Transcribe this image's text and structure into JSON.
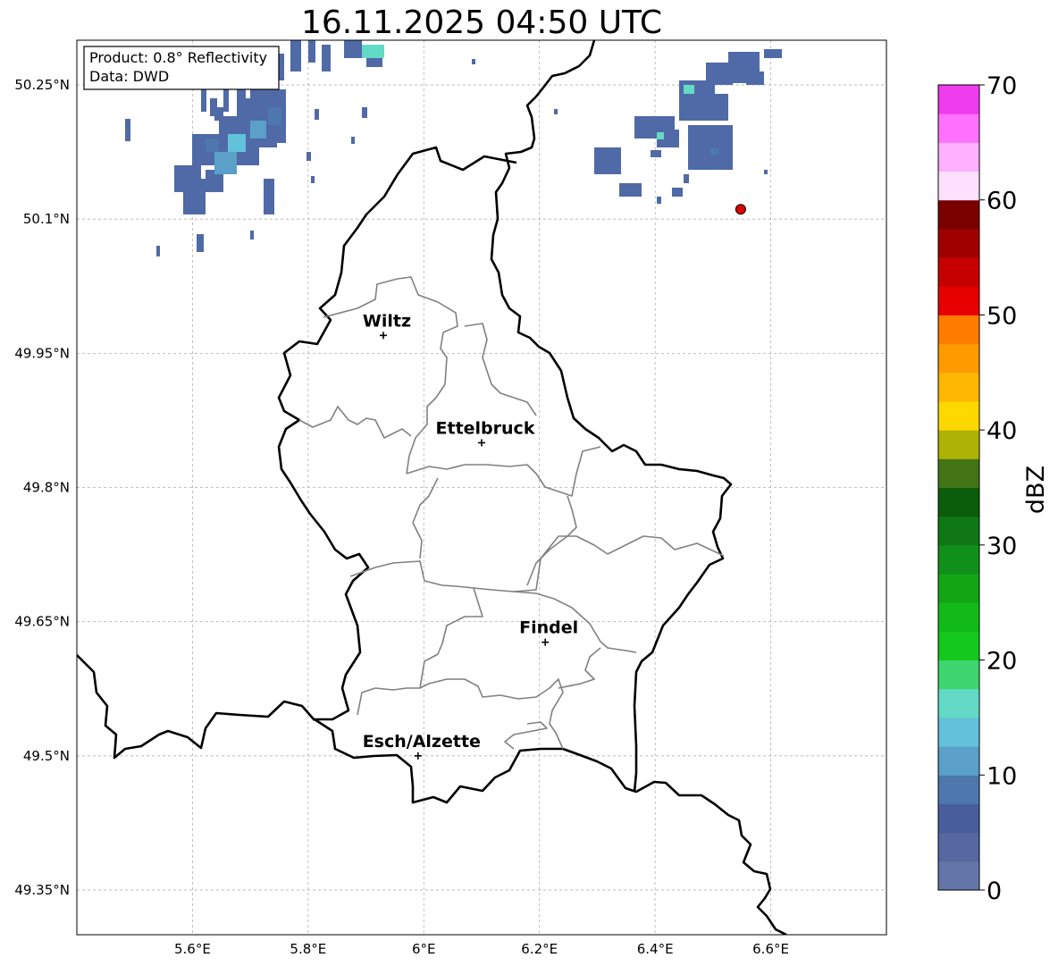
{
  "title": "16.11.2025 04:50 UTC",
  "info_box": {
    "product": "Product: 0.8° Reflectivity",
    "source": "Data: DWD"
  },
  "colorbar": {
    "label": "dBZ",
    "min": 0,
    "max": 70,
    "ticks": [
      "0",
      "10",
      "20",
      "30",
      "40",
      "50",
      "60",
      "70"
    ],
    "bin_step": 2.5,
    "colors": [
      "#6476a8",
      "#55689f",
      "#475d9c",
      "#4d77ad",
      "#5aa0c8",
      "#63c1dc",
      "#62dac6",
      "#3dd66e",
      "#14c81c",
      "#12ba18",
      "#12a614",
      "#10901a",
      "#0f7814",
      "#0b5d0b",
      "#437516",
      "#aeb204",
      "#ffd800",
      "#ffb703",
      "#ff9b00",
      "#ff7c00",
      "#e60000",
      "#c60000",
      "#a00000",
      "#7a0000",
      "#ffe0ff",
      "#ffb0ff",
      "#ff70ff",
      "#ee3cee"
    ]
  },
  "map": {
    "lon_range": [
      5.4,
      6.8
    ],
    "lat_range": [
      49.3,
      50.3
    ],
    "lon_ticks": [
      "5.6°E",
      "5.8°E",
      "6°E",
      "6.2°E",
      "6.4°E",
      "6.6°E"
    ],
    "lat_ticks": [
      "50.25°N",
      "50.1°N",
      "49.95°N",
      "49.8°N",
      "49.65°N",
      "49.5°N",
      "49.35°N"
    ],
    "grid": true
  },
  "cities": [
    {
      "name": "Wiltz",
      "lon": 5.93,
      "lat": 49.97
    },
    {
      "name": "Ettelbruck",
      "lon": 6.1,
      "lat": 49.85
    },
    {
      "name": "Findel",
      "lon": 6.21,
      "lat": 49.627
    },
    {
      "name": "Esch/Alzette",
      "lon": 5.99,
      "lat": 49.5
    }
  ],
  "radar_site": {
    "lon": 6.548,
    "lat": 50.111,
    "color": "#e00000"
  },
  "colors": {
    "border": "#000000",
    "canton_lines": "#808080",
    "grid": "#b0b0b0"
  }
}
